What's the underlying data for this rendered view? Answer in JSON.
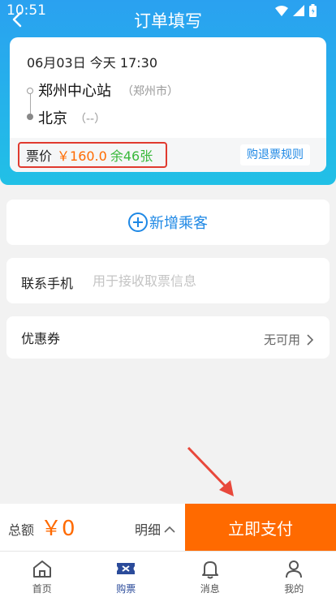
{
  "status_bar": {
    "time": "10:51"
  },
  "nav": {
    "title": "订单填写"
  },
  "ticket": {
    "date": "06月03日 今天 17:30",
    "from_station": "郑州中心站",
    "from_city": "（郑州市）",
    "to_station": "北京",
    "to_city": "（--）",
    "price_label": "票价",
    "price_value": "￥160.0",
    "seats_left": "余46张",
    "refund_rules": "购退票规则"
  },
  "passenger": {
    "add_label": "新增乘客"
  },
  "contact": {
    "label": "联系手机",
    "placeholder": "用于接收取票信息",
    "value": ""
  },
  "coupon": {
    "label": "优惠券",
    "value": "无可用"
  },
  "bottom_bar": {
    "total_label": "总额",
    "total_value": "￥0",
    "detail_label": "明细",
    "pay_label": "立即支付"
  },
  "tabs": [
    {
      "label": "首页",
      "icon": "home-icon",
      "active": false
    },
    {
      "label": "购票",
      "icon": "ticket-icon",
      "active": true
    },
    {
      "label": "消息",
      "icon": "bell-icon",
      "active": false
    },
    {
      "label": "我的",
      "icon": "user-icon",
      "active": false
    }
  ],
  "colors": {
    "header": "#2aa1f0",
    "accent": "#1e88e5",
    "price": "#ff6a00",
    "seats": "#38b83b",
    "highlight": "#e03a2f",
    "tab_active": "#2b4b9a"
  }
}
